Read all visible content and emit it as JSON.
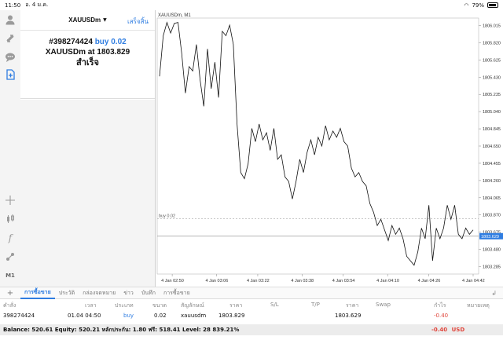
{
  "status_bar": {
    "time": "11:50",
    "date": "อ. 4 ม.ค.",
    "battery": "79%"
  },
  "sidebar": {
    "timeframe_label": "M1",
    "icons": [
      "account-icon",
      "trade-icon",
      "chat-icon",
      "new-order-icon",
      "crosshair-icon",
      "indicators-icon",
      "function-icon",
      "objects-icon"
    ]
  },
  "order_panel": {
    "symbol": "XAUUSDm",
    "done_label": "เสร็จสิ้น",
    "ticket": "#398274424",
    "side": "buy 0.02",
    "symbol_line": "XAUUSDm at",
    "price": "1803.829",
    "status": "สำเร็จ"
  },
  "chart_data": {
    "type": "line",
    "title": "XAUUSDm, M1",
    "price_ticks": [
      "1806.015",
      "1805.820",
      "1805.625",
      "1805.430",
      "1805.235",
      "1805.040",
      "1804.845",
      "1804.650",
      "1804.455",
      "1804.260",
      "1804.065",
      "1803.870",
      "1803.675",
      "1803.480",
      "1803.285"
    ],
    "time_ticks": [
      "4 Jan 02:50",
      "4 Jan 03:06",
      "4 Jan 03:22",
      "4 Jan 03:38",
      "4 Jan 03:54",
      "4 Jan 04:10",
      "4 Jan 04:26",
      "4 Jan 04:42"
    ],
    "ylim": [
      1803.2,
      1806.1
    ],
    "order_line": {
      "label": "buy 0.02",
      "price": 1803.829
    },
    "bid_label": "1803.629",
    "bid_price": 1803.629,
    "values": [
      1805.44,
      1805.9,
      1806.05,
      1805.93,
      1806.04,
      1806.05,
      1805.7,
      1805.25,
      1805.55,
      1805.5,
      1805.8,
      1805.4,
      1805.1,
      1805.75,
      1805.3,
      1805.6,
      1805.2,
      1805.95,
      1805.9,
      1806.02,
      1805.8,
      1804.9,
      1804.35,
      1804.28,
      1804.45,
      1804.85,
      1804.7,
      1804.9,
      1804.72,
      1804.8,
      1804.6,
      1804.85,
      1804.5,
      1804.55,
      1804.3,
      1804.25,
      1804.05,
      1804.25,
      1804.5,
      1804.35,
      1804.58,
      1804.72,
      1804.55,
      1804.75,
      1804.65,
      1804.88,
      1804.72,
      1804.82,
      1804.75,
      1804.85,
      1804.7,
      1804.65,
      1804.4,
      1804.3,
      1804.35,
      1804.25,
      1804.2,
      1804.0,
      1803.9,
      1803.75,
      1803.82,
      1803.7,
      1803.58,
      1803.75,
      1803.65,
      1803.72,
      1803.6,
      1803.4,
      1803.35,
      1803.3,
      1803.45,
      1803.72,
      1803.6,
      1803.98,
      1803.35,
      1803.72,
      1803.6,
      1803.72,
      1803.98,
      1803.82,
      1803.98,
      1803.65,
      1803.6,
      1803.72,
      1803.65,
      1803.7
    ]
  },
  "toolbar": {
    "tabs": [
      "การซื้อขาย",
      "ประวัติ",
      "กล่องจดหมาย",
      "ข่าว",
      "บันทึก",
      "การซื้อขาย"
    ],
    "active_tab": 0
  },
  "trades_table": {
    "headers": [
      "คำสั่ง",
      "เวลา",
      "ประเภท",
      "ขนาด",
      "สัญลักษณ์",
      "ราคา",
      "S/L",
      "T/P",
      "ราคา",
      "Swap",
      "กำไร",
      "หมายเหตุ"
    ],
    "row": [
      "398274424",
      "01.04 04:50",
      "buy",
      "0.02",
      "xauusdm",
      "1803.829",
      "",
      "",
      "1803.629",
      "",
      "-0.40",
      ""
    ]
  },
  "balance_bar": {
    "text": "Balance: 520.61 Equity: 520.21 หลักประกัน: 1.80 ฟรี: 518.41 Level: 28 839.21%",
    "profit": "-0.40",
    "currency": "USD"
  }
}
